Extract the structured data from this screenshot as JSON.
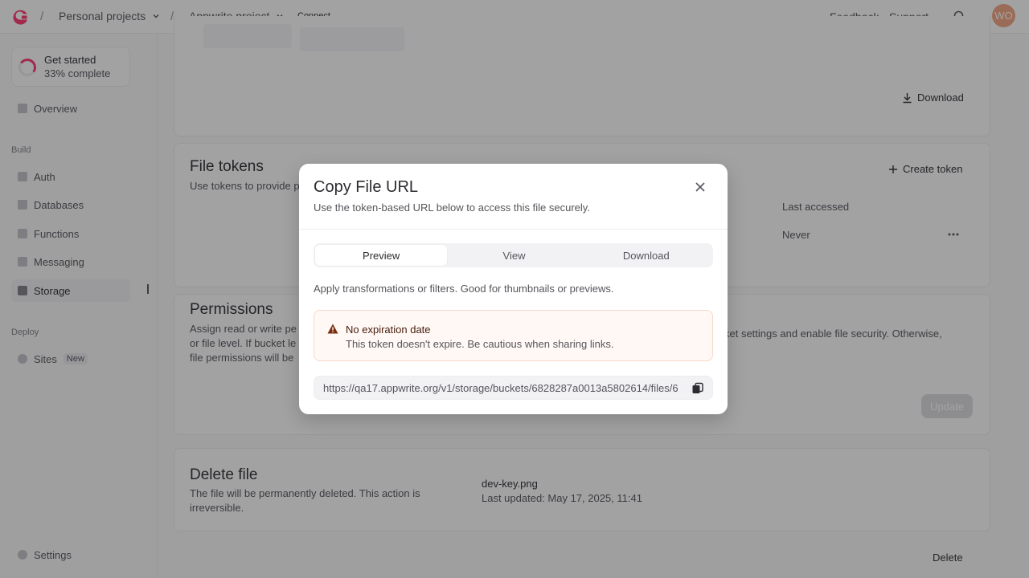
{
  "topbar": {
    "org": "Personal projects",
    "project": "Appwrite project",
    "connect": "Connect",
    "feedback": "Feedback",
    "support": "Support",
    "avatar_initials": "WO"
  },
  "sidebar": {
    "get_started_title": "Get started",
    "get_started_progress": "33% complete",
    "overview": "Overview",
    "build_label": "Build",
    "items_build": [
      "Auth",
      "Databases",
      "Functions",
      "Messaging",
      "Storage"
    ],
    "deploy_label": "Deploy",
    "sites": "Sites",
    "sites_badge": "New",
    "settings": "Settings"
  },
  "main": {
    "download_label": "Download",
    "tokens_title": "File tokens",
    "tokens_desc": "Use tokens to provide p",
    "create_token": "Create token",
    "col_last_accessed": "Last accessed",
    "row_last_accessed": "Never",
    "permissions_title": "Permissions",
    "permissions_desc_1": "Assign read or write pe",
    "permissions_desc_2": "or file level. If bucket le",
    "permissions_desc_3": "file permissions will be",
    "permissions_right": "ket settings and enable file security. Otherwise,",
    "update_label": "Update",
    "delete_title": "Delete file",
    "delete_desc_1": "The file will be permanently deleted. This action is",
    "delete_desc_2": "irreversible.",
    "file_name": "dev-key.png",
    "file_updated": "Last updated: May 17, 2025, 11:41",
    "delete_label": "Delete"
  },
  "modal": {
    "title": "Copy File URL",
    "subtitle": "Use the token-based URL below to access this file securely.",
    "tabs": [
      "Preview",
      "View",
      "Download"
    ],
    "active_tab": "Preview",
    "info": "Apply transformations or filters. Good for thumbnails or previews.",
    "alert_title": "No expiration date",
    "alert_text": "This token doesn't expire. Be cautious when sharing links.",
    "url": "https://qa17.appwrite.org/v1/storage/buckets/6828287a0013a5802614/files/6"
  },
  "colors": {
    "brand": "#fd366e",
    "avatar_bg": "#f2a581",
    "warning_bg": "#fff8f5",
    "warning_icon": "#7a2e0e"
  }
}
